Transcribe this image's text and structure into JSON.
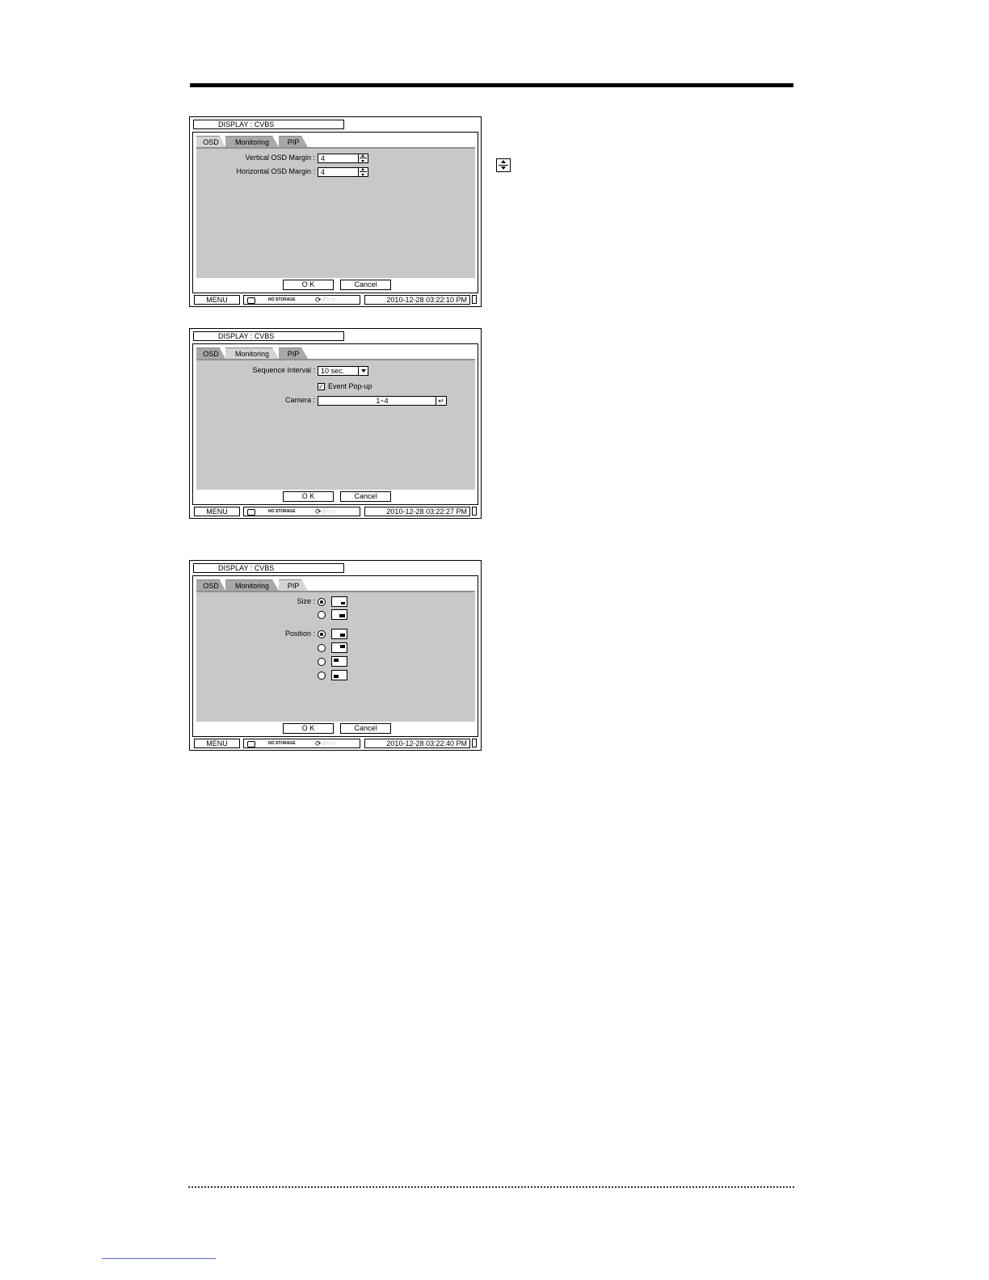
{
  "screens": [
    {
      "title": "DISPLAY : CVBS",
      "tabs": [
        "OSD",
        "Monitoring",
        "PIP"
      ],
      "active_tab": "OSD",
      "fields": {
        "vertical_label": "Vertical OSD Margin :",
        "vertical_value": "4",
        "horizontal_label": "Horizontal OSD Margin :",
        "horizontal_value": "4"
      },
      "ok": "O K",
      "cancel": "Cancel",
      "status": {
        "menu": "MENU",
        "storage": "NO STORAGE",
        "clock": "2010-12-28 03:22:10 PM"
      }
    },
    {
      "title": "DISPLAY : CVBS",
      "tabs": [
        "OSD",
        "Monitoring",
        "PIP"
      ],
      "active_tab": "Monitoring",
      "fields": {
        "sequence_label": "Sequence Interval :",
        "sequence_value": "10 sec.",
        "event_popup_label": "Event Pop-up",
        "event_popup_checked": true,
        "camera_label": "Camera :",
        "camera_value": "1~4"
      },
      "ok": "O K",
      "cancel": "Cancel",
      "status": {
        "menu": "MENU",
        "storage": "NO STORAGE",
        "clock": "2010-12-28 03:22:27 PM"
      }
    },
    {
      "title": "DISPLAY : CVBS",
      "tabs": [
        "OSD",
        "Monitoring",
        "PIP"
      ],
      "active_tab": "PIP",
      "fields": {
        "size_label": "Size :",
        "size_options": [
          "small",
          "large"
        ],
        "size_selected": "small",
        "position_label": "Position :",
        "position_options": [
          "bottom-right",
          "top-right",
          "top-left",
          "bottom-left"
        ],
        "position_selected": "bottom-right"
      },
      "ok": "O K",
      "cancel": "Cancel",
      "status": {
        "menu": "MENU",
        "storage": "NO STORAGE",
        "clock": "2010-12-28 03:22:40 PM"
      }
    }
  ],
  "side_icon": "spin-up-down-icon"
}
